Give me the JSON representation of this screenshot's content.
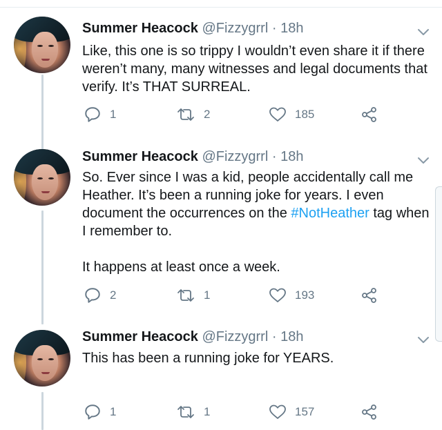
{
  "tweets": [
    {
      "name": "Summer Heacock",
      "handle": "@Fizzygrrl",
      "separator": "·",
      "time": "18h",
      "body": [
        {
          "text": "Like, this one is so trippy I wouldn’t even share it if there weren’t many, many witnesses and legal documents that verify. It’s THAT SURREAL."
        }
      ],
      "replies": "1",
      "retweets": "2",
      "likes": "185"
    },
    {
      "name": "Summer Heacock",
      "handle": "@Fizzygrrl",
      "separator": "·",
      "time": "18h",
      "body": [
        {
          "before": "So. Ever since I was a kid, people accidentally call me Heather. It’s been a running joke for years. I even document the occurrences on the ",
          "hashtag": "#NotHeather",
          "after": " tag when I remember to."
        },
        {
          "text": "It happens at least once a week."
        }
      ],
      "replies": "2",
      "retweets": "1",
      "likes": "193"
    },
    {
      "name": "Summer Heacock",
      "handle": "@Fizzygrrl",
      "separator": "·",
      "time": "18h",
      "body": [
        {
          "text": "This has been a running joke for YEARS."
        }
      ],
      "replies": "1",
      "retweets": "1",
      "likes": "157"
    }
  ],
  "icons": {
    "reply": "reply-icon",
    "retweet": "retweet-icon",
    "like": "heart-icon",
    "share": "share-icon",
    "menu": "chevron-down-icon"
  },
  "colors": {
    "text": "#14171a",
    "secondary": "#657786",
    "link": "#1da1f2",
    "thread_line": "#ccd6dd"
  }
}
